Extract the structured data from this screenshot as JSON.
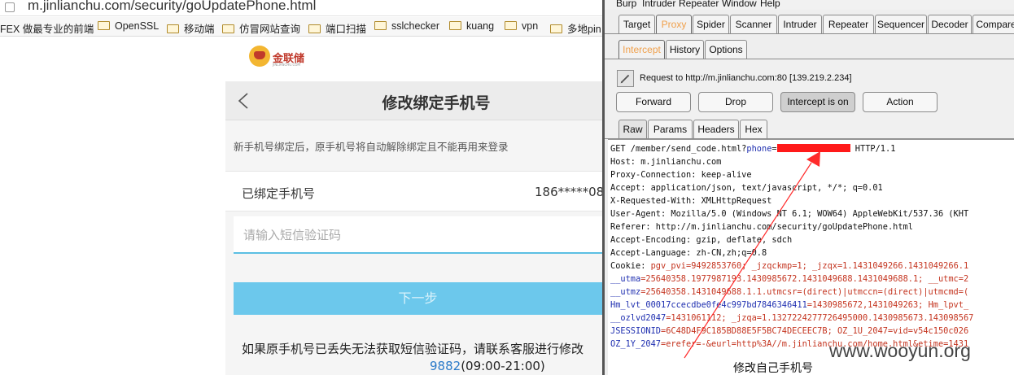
{
  "browser": {
    "url": "m.jinlianchu.com/security/goUpdatePhone.html",
    "bookmarks": [
      "FEX 做最专业的前端",
      "OpenSSL",
      "移动端",
      "仿冒网站查询",
      "端口扫描",
      "sslchecker",
      "kuang",
      "vpn",
      "多地pin"
    ]
  },
  "page": {
    "logo_text": "金联储",
    "logo_sub": "JINLIANCHU.COM",
    "title": "修改绑定手机号",
    "notice": "新手机号绑定后，原手机号将自动解除绑定且不能再用来登录",
    "bound_label": "已绑定手机号",
    "bound_value": "186*****08",
    "code_placeholder": "请输入短信验证码",
    "next_label": "下一步",
    "help_text": "如果原手机号已丢失无法获取短信验证码，请联系客服进行修改",
    "help_phone": "9882",
    "help_hours": "(09:00-21:00)"
  },
  "burp": {
    "menu": [
      "Burp",
      "Intruder",
      "Repeater",
      "Window",
      "Help"
    ],
    "main_tabs": [
      "Target",
      "Proxy",
      "Spider",
      "Scanner",
      "Intruder",
      "Repeater",
      "Sequencer",
      "Decoder",
      "Compare"
    ],
    "sub_tabs": [
      "Intercept",
      "History",
      "Options"
    ],
    "request_info": "Request to http://m.jinlianchu.com:80  [139.219.2.234]",
    "buttons": [
      "Forward",
      "Drop",
      "Intercept is on",
      "Action"
    ],
    "view_tabs": [
      "Raw",
      "Params",
      "Headers",
      "Hex"
    ],
    "raw": {
      "get_prefix": "GET /member/send_code.html?",
      "get_key": "phone",
      "get_eq": "=",
      "get_suffix": " HTTP/1.1",
      "lines": [
        "Host: m.jinlianchu.com",
        "Proxy-Connection: keep-alive",
        "Accept: application/json, text/javascript, */*; q=0.01",
        "X-Requested-With: XMLHttpRequest",
        "User-Agent: Mozilla/5.0 (Windows NT 6.1; WOW64) AppleWebKit/537.36 (KHT",
        "Referer: http://m.jinlianchu.com/security/goUpdatePhone.html",
        "Accept-Encoding: gzip, deflate, sdch",
        "Accept-Language: zh-CN,zh;q=0.8"
      ],
      "cookie_lines": [
        {
          "k": "Cookie: ",
          "v": "pgv_pvi=9492853760; _jzqckmp=1; _jzqx=1.1431049266.1431049266.1"
        },
        {
          "k": "__utma",
          "v": "=25640358.1977987193.1430985672.1431049688.1431049688.1; __utmc=2"
        },
        {
          "k": "__utmz",
          "v": "=25640358.1431049688.1.1.utmcsr=(direct)|utmccn=(direct)|utmcmd=("
        },
        {
          "k": "Hm_lvt_00017ccecdbe0fe4c997bd7846346411",
          "v": "=1430985672,1431049263; Hm_lpvt_"
        },
        {
          "k": "__ozlvd2047",
          "v": "=1431061112; _jzqa=1.1327224277726495000.1430985673.143098567"
        },
        {
          "k": "JSESSIONID",
          "v": "=6C48D4F9C185BD88E5F5BC74DECEEC7B; OZ_1U_2047=vid=v54c150c026"
        },
        {
          "k": "OZ_1Y_2047",
          "v": "=erefer=-&eurl=http%3A//m.jinlianchu.com/home.html&etime=1431"
        }
      ]
    },
    "annotation": "修改自己手机号",
    "watermark": "www.wooyun.org",
    "colors": {
      "accent": "#f0a04b",
      "key": "#1f2fb0",
      "value": "#c4341f",
      "redact": "#ff1a1a"
    }
  }
}
